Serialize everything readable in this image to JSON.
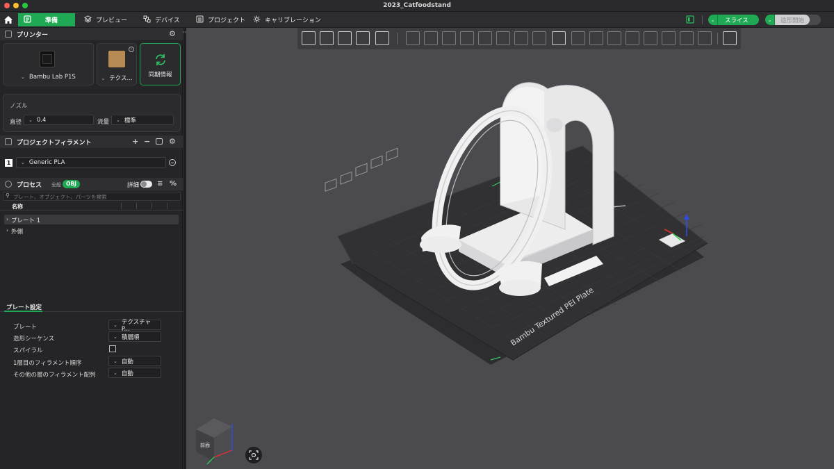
{
  "window": {
    "title": "2023_Catfoodstand"
  },
  "menu": {
    "tabs": [
      {
        "label": "準備",
        "icon": "prepare-icon",
        "active": true
      },
      {
        "label": "プレビュー",
        "icon": "preview-icon",
        "active": false
      },
      {
        "label": "デバイス",
        "icon": "device-icon",
        "active": false
      },
      {
        "label": "プロジェクト",
        "icon": "project-icon",
        "active": false
      },
      {
        "label": "キャリブレーション",
        "icon": "calibration-icon",
        "active": false
      }
    ],
    "slice_label": "スライス",
    "print_label": "造形開始"
  },
  "printer": {
    "section_title": "プリンター",
    "printer_name": "Bambu Lab P1S",
    "plate_name": "テクス...",
    "sync_label": "同期情報"
  },
  "nozzle": {
    "title": "ノズル",
    "diameter_label": "直径",
    "diameter_value": "0.4",
    "flow_label": "流量",
    "flow_value": "標準"
  },
  "filament": {
    "section_title": "プロジェクトフィラメント",
    "items": [
      {
        "index": "1",
        "name": "Generic PLA"
      }
    ]
  },
  "process": {
    "section_title": "プロセス",
    "global_label": "全般",
    "obj_label": "OBJ",
    "detail_label": "詳細",
    "search_placeholder": "プレート、オブジェクト、パーツを検索",
    "column_name": "名称",
    "tree": [
      {
        "label": "プレート 1",
        "selected": true
      },
      {
        "label": "外側",
        "selected": false
      }
    ]
  },
  "plate_settings": {
    "tab_label": "プレート設定",
    "rows": [
      {
        "label": "プレート",
        "value": "テクスチャ P..."
      },
      {
        "label": "造形シーケンス",
        "value": "積層順"
      },
      {
        "label": "スパイラル",
        "value": ""
      },
      {
        "label": "1層目のフィラメント順序",
        "value": "自動"
      },
      {
        "label": "その他の層のフィラメント配列",
        "value": "自動"
      }
    ]
  },
  "viewport": {
    "bed_label": "Bambu Textured PEI Plate",
    "cube_face_label": "前面"
  },
  "colors": {
    "accent": "#1fa955",
    "bed": "#2c2c2e",
    "background": "#4a4a4f",
    "model": "#e9e9ea"
  }
}
